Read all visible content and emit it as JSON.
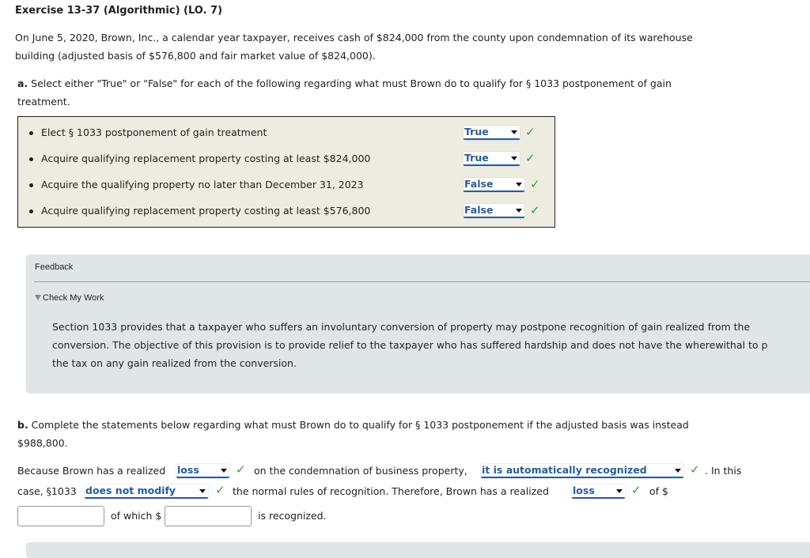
{
  "title": "Exercise 13-37 (Algorithmic) (LO. 7)",
  "intro_line1": "On June 5, 2020, Brown, Inc., a calendar year taxpayer, receives cash of $824,000 from the county upon condemnation of its warehouse",
  "intro_line2": "building (adjusted basis of $576,800 and fair market value of $824,000).",
  "part_a": {
    "label": "a.",
    "line1": " Select either \"True\" or \"False\" for each of the following regarding what must Brown do to qualify for § 1033 postponement of gain",
    "line2": "treatment.",
    "items": [
      {
        "text": "Elect § 1033 postponement of gain treatment",
        "answer": "True",
        "correct": true
      },
      {
        "text": "Acquire qualifying replacement property costing at least $824,000",
        "answer": "True",
        "correct": true
      },
      {
        "text": "Acquire the qualifying property no later than December 31, 2023",
        "answer": "False",
        "correct": true
      },
      {
        "text": "Acquire qualifying replacement property costing at least $576,800",
        "answer": "False",
        "correct": true
      }
    ]
  },
  "feedback": {
    "label": "Feedback",
    "toggle": "Check My Work",
    "lines": [
      "Section 1033 provides that a taxpayer who suffers an involuntary conversion of property may postpone recognition of gain realized from the",
      "conversion. The objective of this provision is to provide relief to the taxpayer who has suffered hardship and does not have the wherewithal to p",
      "the tax on any gain realized from the conversion."
    ]
  },
  "part_b": {
    "label": "b.",
    "line1": " Complete the statements below regarding what must Brown do to qualify for § 1033 postponement if the adjusted basis was instead",
    "line2": "$988,800.",
    "s1": "Because Brown has a realized",
    "sel1": "loss",
    "s2": "on the condemnation of business property,",
    "sel2": "it is automatically recognized",
    "s3": ". In this",
    "s4": "case, §1033",
    "sel3": "does not modify",
    "s5": "the normal rules of recognition. Therefore, Brown has a realized",
    "sel4": "loss",
    "s6": "of $",
    "input1": "",
    "s7": "of which $",
    "input2": "",
    "s8": "is recognized."
  },
  "colors": {
    "accent": "#2a5b99",
    "check": "#3b9a3b",
    "panel": "#eeece0",
    "feedback_bg": "#e0e6e8"
  }
}
